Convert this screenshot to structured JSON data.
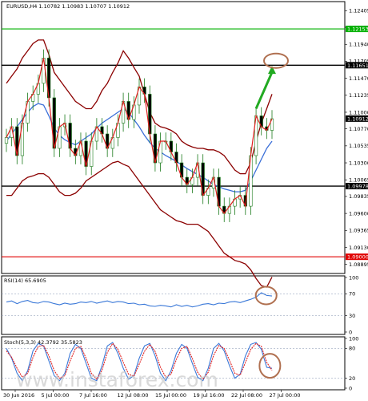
{
  "chart_data": [
    {
      "type": "candlestick",
      "header": "EURUSD,H4  1.10782 1.10983 1.10707 1.10912",
      "y_ticks": [
        "1.12405",
        "1.12175",
        "1.11940",
        "1.11705",
        "1.11470",
        "1.11235",
        "1.11000",
        "1.10770",
        "1.10535",
        "1.10300",
        "1.10065",
        "1.09835",
        "1.09600",
        "1.09365",
        "1.09130",
        "1.08895"
      ],
      "ylim": [
        1.0878,
        1.1252
      ],
      "levels": [
        {
          "label": "1.12153",
          "value": 1.12153,
          "color": "#00b000"
        },
        {
          "label": "1.11651",
          "value": 1.11651,
          "color": "#000000"
        },
        {
          "label": "1.09978",
          "value": 1.09978,
          "color": "#000000"
        },
        {
          "label": "1.09000",
          "value": 1.09,
          "color": "#e00000"
        }
      ],
      "current": {
        "label": "1.10912",
        "value": 1.10912
      },
      "close": [
        1.1065,
        1.108,
        1.104,
        1.1085,
        1.1115,
        1.1125,
        1.114,
        1.1175,
        1.112,
        1.105,
        1.108,
        1.1085,
        1.105,
        1.104,
        1.106,
        1.1025,
        1.106,
        1.108,
        1.107,
        1.105,
        1.1065,
        1.1085,
        1.1115,
        1.109,
        1.111,
        1.1135,
        1.1125,
        1.107,
        1.103,
        1.106,
        1.106,
        1.1045,
        1.103,
        1.101,
        1.1,
        1.101,
        1.103,
        1.0985,
        1.0995,
        1.101,
        1.097,
        1.096,
        1.097,
        1.098,
        1.0985,
        1.097,
        1.104,
        1.1095,
        1.108,
        1.1075,
        1.1091
      ],
      "bb_upper": [
        1.114,
        1.115,
        1.116,
        1.1175,
        1.1185,
        1.1195,
        1.12,
        1.12,
        1.118,
        1.1155,
        1.1145,
        1.1135,
        1.1125,
        1.1115,
        1.111,
        1.1105,
        1.1105,
        1.1115,
        1.113,
        1.114,
        1.1155,
        1.1168,
        1.1185,
        1.1175,
        1.1162,
        1.115,
        1.1125,
        1.11,
        1.1085,
        1.108,
        1.1078,
        1.1075,
        1.107,
        1.106,
        1.1055,
        1.1052,
        1.105,
        1.105,
        1.1048,
        1.1048,
        1.1045,
        1.104,
        1.103,
        1.102,
        1.1015,
        1.1015,
        1.103,
        1.106,
        1.1085,
        1.1105,
        1.1125
      ],
      "bb_middle": [
        1.106,
        1.107,
        1.108,
        1.109,
        1.11,
        1.1108,
        1.1112,
        1.111,
        1.1095,
        1.1078,
        1.1068,
        1.1062,
        1.1058,
        1.1055,
        1.106,
        1.1065,
        1.107,
        1.1078,
        1.1085,
        1.109,
        1.1095,
        1.11,
        1.1105,
        1.11,
        1.109,
        1.108,
        1.1068,
        1.1058,
        1.105,
        1.1045,
        1.104,
        1.1036,
        1.1032,
        1.1027,
        1.1022,
        1.1018,
        1.1014,
        1.101,
        1.1005,
        1.1,
        1.0997,
        1.0994,
        1.0992,
        1.099,
        1.099,
        1.0992,
        1.1005,
        1.102,
        1.1035,
        1.105,
        1.106
      ],
      "bb_lower": [
        1.0985,
        1.0985,
        1.0995,
        1.1005,
        1.101,
        1.1012,
        1.1015,
        1.1015,
        1.101,
        1.1,
        1.099,
        1.0985,
        1.0985,
        1.0988,
        1.0995,
        1.1005,
        1.101,
        1.1015,
        1.102,
        1.1025,
        1.103,
        1.1032,
        1.1028,
        1.1025,
        1.1015,
        1.1005,
        1.0995,
        1.0985,
        1.0975,
        1.0965,
        1.096,
        1.0955,
        1.095,
        1.0948,
        1.0945,
        1.0945,
        1.0945,
        1.094,
        1.0935,
        1.0925,
        1.0915,
        1.0905,
        1.09,
        1.0895,
        1.0893,
        1.089,
        1.0882,
        1.087,
        1.086,
        1.0858,
        1.0872
      ],
      "annotation": {
        "type": "arrow",
        "from": [
          47,
          1.1105
        ],
        "to": [
          50,
          1.1162
        ],
        "color": "#22aa22"
      },
      "circle": {
        "at": [
          50,
          1.1168
        ]
      }
    },
    {
      "type": "line",
      "title": "RSI(14) 65.6905",
      "y_ticks": [
        "100",
        "70",
        "30",
        "0"
      ],
      "ylim": [
        0,
        100
      ],
      "values": [
        55,
        57,
        52,
        56,
        58,
        54,
        53,
        56,
        55,
        52,
        50,
        53,
        51,
        52,
        55,
        54,
        56,
        53,
        55,
        57,
        54,
        56,
        55,
        52,
        53,
        50,
        51,
        48,
        47,
        49,
        48,
        46,
        50,
        47,
        49,
        46,
        48,
        51,
        52,
        50,
        53,
        52,
        55,
        56,
        54,
        57,
        60,
        64,
        72,
        67,
        66
      ],
      "circle": {
        "at": [
          48,
          67
        ]
      }
    },
    {
      "type": "line",
      "title": "Stoch(5,3,3) 42.3792 35.5823",
      "y_ticks": [
        "100",
        "80",
        "20",
        "0"
      ],
      "ylim": [
        0,
        100
      ],
      "series": [
        {
          "values": [
            80,
            60,
            30,
            15,
            35,
            75,
            90,
            85,
            55,
            25,
            15,
            30,
            70,
            88,
            80,
            50,
            20,
            15,
            45,
            85,
            92,
            70,
            40,
            18,
            25,
            60,
            85,
            90,
            65,
            30,
            15,
            35,
            70,
            88,
            80,
            50,
            22,
            15,
            40,
            80,
            90,
            75,
            45,
            20,
            28,
            65,
            88,
            92,
            78,
            42,
            40
          ]
        },
        {
          "values": [
            75,
            62,
            40,
            22,
            30,
            62,
            84,
            86,
            65,
            35,
            20,
            25,
            55,
            80,
            84,
            60,
            30,
            18,
            36,
            72,
            90,
            78,
            52,
            28,
            24,
            48,
            74,
            88,
            74,
            42,
            22,
            28,
            58,
            80,
            84,
            60,
            32,
            18,
            32,
            66,
            86,
            80,
            56,
            30,
            26,
            52,
            78,
            90,
            84,
            52,
            36
          ]
        }
      ],
      "circle": {
        "at": [
          49,
          45
        ]
      }
    }
  ],
  "x_ticks": [
    "30 Jun 2016",
    "5 Jul 00:00",
    "7 Jul 16:00",
    "12 Jul 08:00",
    "15 Jul 00:00",
    "19 Jul 16:00",
    "22 Jul 08:00",
    "27 Jul 00:00"
  ],
  "watermark": "www.instaforex.com"
}
